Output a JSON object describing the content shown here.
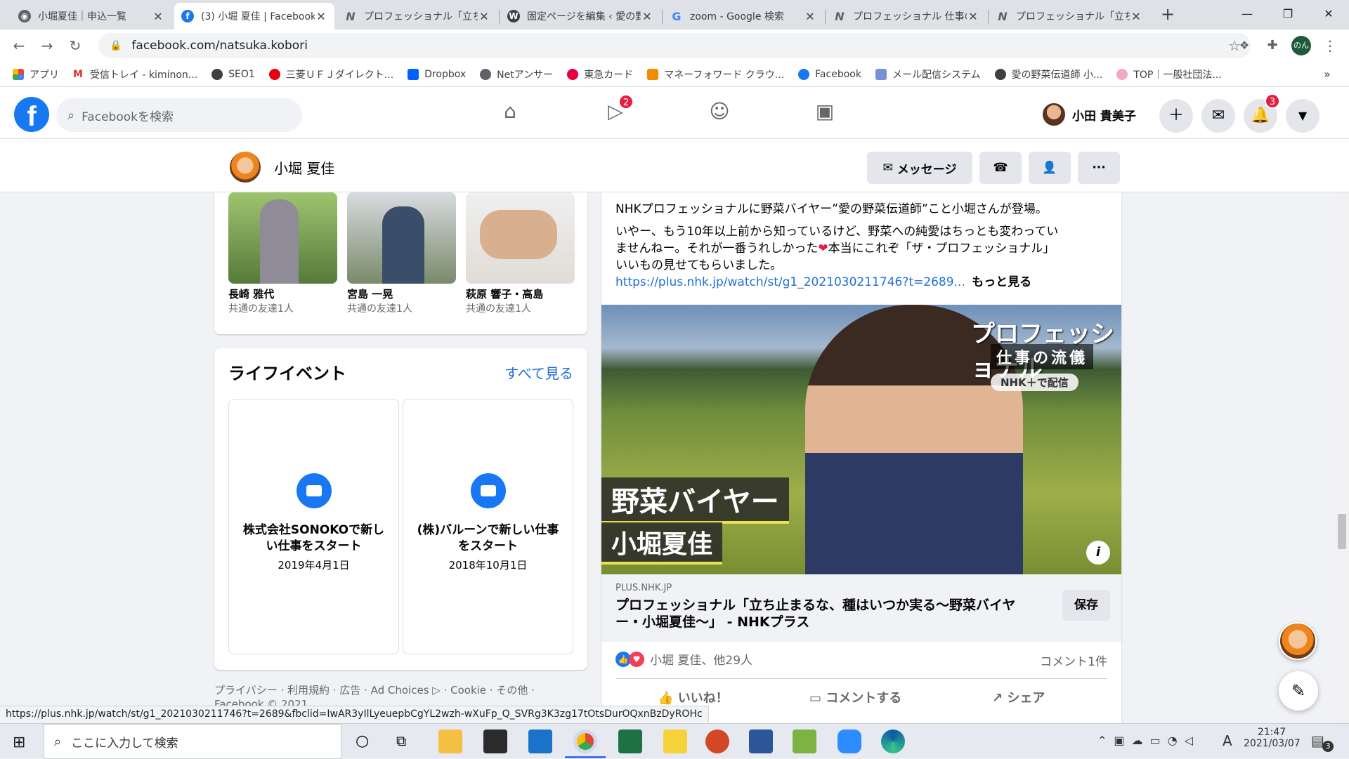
{
  "browser": {
    "tabs": [
      {
        "title": "小堀夏佳｜申込一覧",
        "active": false
      },
      {
        "title": "(3) 小堀 夏佳 | Facebook",
        "active": true
      },
      {
        "title": "プロフェッショナル「立ち止まるな",
        "active": false
      },
      {
        "title": "固定ページを編集 ‹ 愛の野菜",
        "active": false
      },
      {
        "title": "zoom - Google 検索",
        "active": false
      },
      {
        "title": "プロフェッショナル 仕事の流儀",
        "active": false
      },
      {
        "title": "プロフェッショナル「立ち止まるな",
        "active": false
      }
    ],
    "new_tab": "+",
    "url": "facebook.com/natsuka.kobori",
    "profile_initials": "のん",
    "bookmarks": [
      "アプリ",
      "受信トレイ - kiminon...",
      "SEO1",
      "三菱ＵＦＪダイレクト...",
      "Dropbox",
      "Netアンサー",
      "東急カード",
      "マネーフォワード クラウ...",
      "Facebook",
      "メール配信システム",
      "愛の野菜伝道師 小...",
      "TOP｜一般社団法..."
    ],
    "bookmarks_more": "»",
    "status_url": "https://plus.nhk.jp/watch/st/g1_2021030211746?t=2689&fbclid=IwAR3yIlLyeuepbCgYL2wzh-wXuFp_Q_SVRg3K3zg17tOtsDurOQxnBzDyROHc"
  },
  "fb": {
    "search_placeholder": "Facebookを検索",
    "watch_badge": "2",
    "notif_badge": "3",
    "user_name": "小田 貴美子",
    "profile_name": "小堀 夏佳",
    "message_button": "メッセージ",
    "more_button": "···"
  },
  "friends": [
    {
      "name": "長崎 雅代",
      "mutual": "共通の友達1人"
    },
    {
      "name": "宮島 一晃",
      "mutual": "共通の友達1人"
    },
    {
      "name": "萩原 響子・高島",
      "mutual": "共通の友達1人"
    }
  ],
  "life_events": {
    "title": "ライフイベント",
    "see_all": "すべて見る",
    "items": [
      {
        "title": "株式会社SONOKOで新しい仕事をスタート",
        "date": "2019年4月1日"
      },
      {
        "title": "(株)バルーンで新しい仕事をスタート",
        "date": "2018年10月1日"
      }
    ]
  },
  "footer": {
    "links": "プライバシー · 利用規約 · 広告 · Ad Choices ▷ · Cookie · その他 ·",
    "copyright": "Facebook © 2021"
  },
  "post": {
    "line1": "NHKプロフェッショナルに野菜バイヤー”愛の野菜伝道師”こと小堀さんが登場。",
    "line2": "いやー、もう10年以上前から知っているけど、野菜への純愛はちっとも変わってい",
    "line3": "ませんねー。それが一番うれしかった",
    "line3b": "本当にこれぞ「ザ・プロフェッショナル」",
    "line4": "いいもの見せてもらいました。",
    "link": "https://plus.nhk.jp/watch/st/g1_2021030211746?t=2689...",
    "more": "もっと見る",
    "image_logo1": "プロフェッショナル",
    "image_logo2": "仕事の流儀",
    "image_logo3": "NHK＋で配信",
    "image_caption1": "野菜バイヤー",
    "image_caption2": "小堀夏佳",
    "domain": "PLUS.NHK.JP",
    "link_title": "プロフェッショナル「立ち止まるな、種はいつか実る〜野菜バイヤー・小堀夏佳〜」 - NHKプラス",
    "save": "保存",
    "reactions": "小堀 夏佳、他29人",
    "comments": "コメント1件",
    "like": "いいね！",
    "comment": "コメントする",
    "share": "シェア"
  },
  "taskbar": {
    "search_placeholder": "ここに入力して検索",
    "ime": "A",
    "time": "21:47",
    "date": "2021/03/07",
    "notif_count": "3"
  },
  "colors": {
    "fb_blue": "#1877f2",
    "badge_red": "#e41e3f",
    "link_blue": "#216fdb"
  }
}
